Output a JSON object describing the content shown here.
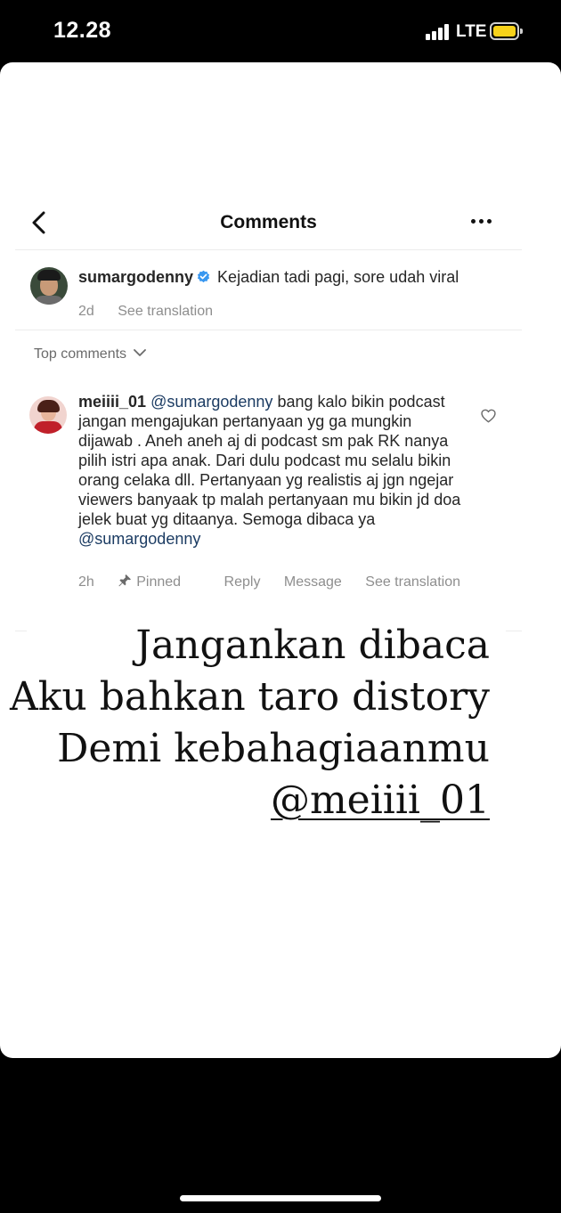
{
  "status_bar": {
    "time": "12.28",
    "network": "LTE",
    "battery_color": "#f7d21a"
  },
  "header": {
    "title": "Comments",
    "back_icon": "chevron-left-icon",
    "more_icon": "more-horizontal-icon"
  },
  "post": {
    "username": "sumargodenny",
    "verified": true,
    "caption": "Kejadian tadi pagi, sore udah viral",
    "age": "2d",
    "see_translation": "See translation"
  },
  "sort": {
    "label": "Top comments"
  },
  "comment": {
    "username": "meiiii_01",
    "mention_start": "@sumargodenny",
    "body": "bang kalo bikin podcast jangan mengajukan pertanyaan yg ga mungkin dijawab . Aneh aneh aj di podcast sm pak RK nanya pilih istri apa anak. Dari dulu podcast mu selalu bikin orang celaka dll. Pertanyaan yg realistis aj jgn ngejar viewers banyaak tp malah pertanyaan mu bikin jd doa jelek buat yg ditaanya. Semoga dibaca ya",
    "mention_end": "@sumargodenny",
    "age": "2h",
    "pinned": "Pinned",
    "reply": "Reply",
    "message": "Message",
    "see_translation": "See translation"
  },
  "story": {
    "line1": "Jangankan dibaca",
    "line2": "Aku bahkan taro distory",
    "line3": "Demi kebahagiaanmu",
    "line4": "@meiiii_01"
  },
  "colors": {
    "mention": "#1c3c63",
    "verified": "#3897f0",
    "meta": "#8e8e8e"
  }
}
